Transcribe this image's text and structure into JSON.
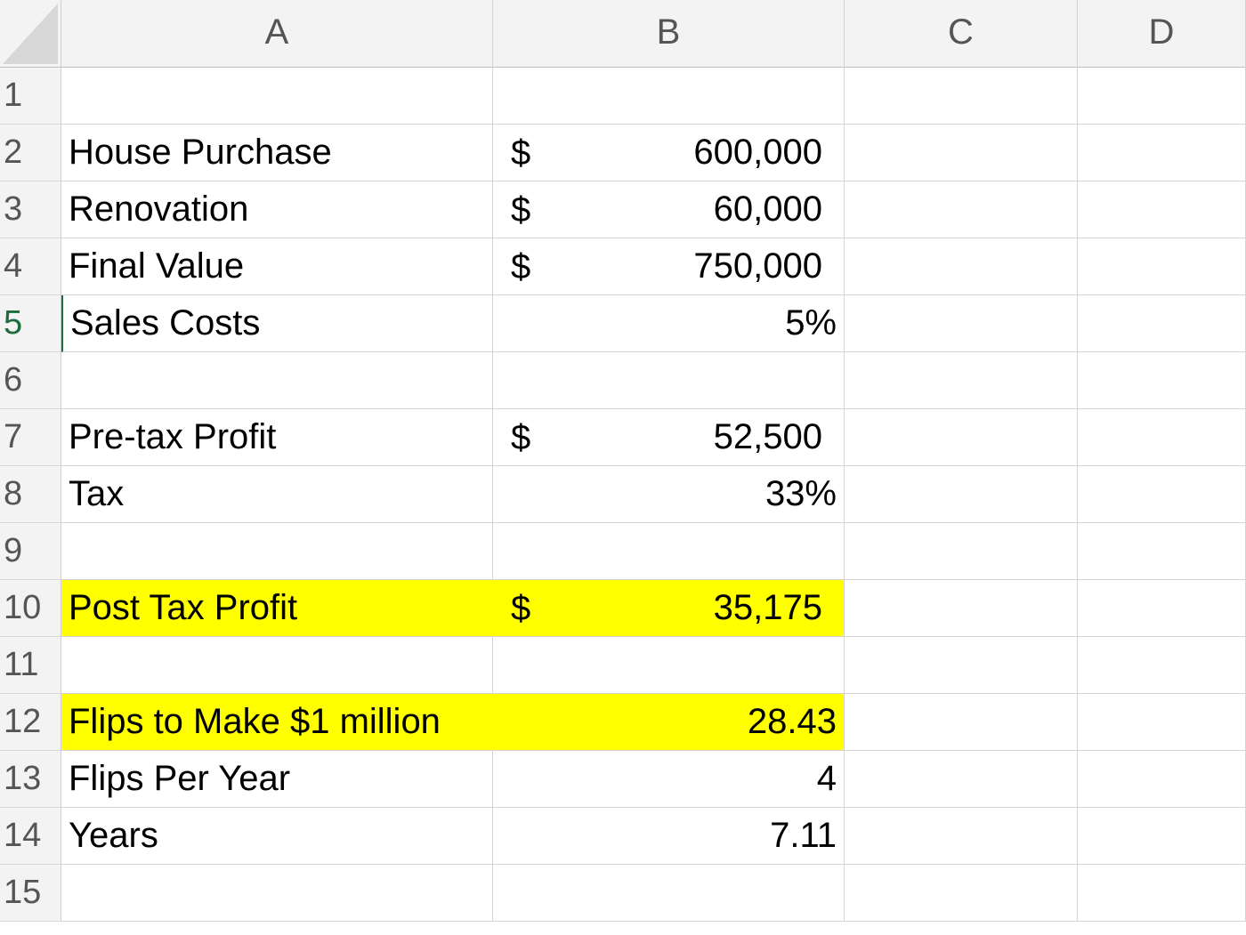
{
  "columns": [
    "A",
    "B",
    "C",
    "D"
  ],
  "rows": [
    {
      "num": "1",
      "label": "",
      "currency": "",
      "value": ""
    },
    {
      "num": "2",
      "label": "House Purchase",
      "currency": "$",
      "value": "600,000"
    },
    {
      "num": "3",
      "label": "Renovation",
      "currency": "$",
      "value": "60,000"
    },
    {
      "num": "4",
      "label": "Final Value",
      "currency": "$",
      "value": "750,000"
    },
    {
      "num": "5",
      "label": "Sales Costs",
      "currency": "",
      "value": "5%"
    },
    {
      "num": "6",
      "label": "",
      "currency": "",
      "value": ""
    },
    {
      "num": "7",
      "label": "Pre-tax Profit",
      "currency": "$",
      "value": "52,500"
    },
    {
      "num": "8",
      "label": "Tax",
      "currency": "",
      "value": "33%"
    },
    {
      "num": "9",
      "label": "",
      "currency": "",
      "value": ""
    },
    {
      "num": "10",
      "label": "Post Tax Profit",
      "currency": "$",
      "value": "35,175"
    },
    {
      "num": "11",
      "label": "",
      "currency": "",
      "value": ""
    },
    {
      "num": "12",
      "label": "Flips to Make $1 million",
      "currency": "",
      "value": "28.43"
    },
    {
      "num": "13",
      "label": "Flips Per Year",
      "currency": "",
      "value": "4"
    },
    {
      "num": "14",
      "label": "Years",
      "currency": "",
      "value": "7.11"
    },
    {
      "num": "15",
      "label": "",
      "currency": "",
      "value": ""
    }
  ],
  "selected_row": "5",
  "highlight_color": "#ffff00",
  "selection_color": "#1e6b3c"
}
